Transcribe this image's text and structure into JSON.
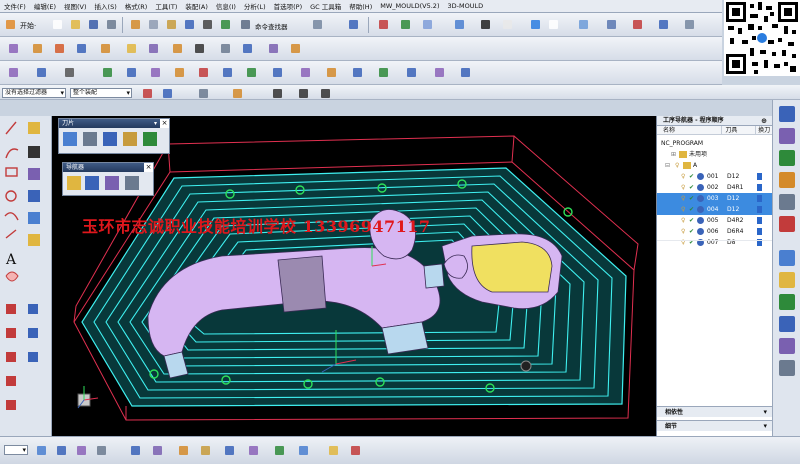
{
  "menu": [
    "文件(F)",
    "编辑(E)",
    "视图(V)",
    "插入(S)",
    "格式(R)",
    "工具(T)",
    "装配(A)",
    "信息(I)",
    "分析(L)",
    "首选项(P)",
    "GC 工具箱",
    "帮助(H)",
    "MW_MOULD(V5.2)",
    "3D-MOULD"
  ],
  "toolbar": {
    "start_label": "开始·",
    "command_finder_label": "命令查找器"
  },
  "selection_filter": {
    "value": "没有选择过滤器",
    "scope": "整个装配"
  },
  "palettes": {
    "tools_title": "刀片",
    "nav_title": "导航器"
  },
  "watermark": "玉环市志诚职业技能培训学校 13396947117",
  "colors": {
    "accent": "#3c8be0",
    "toolpath": "#3ff0f0",
    "part": "#c9a6ee",
    "watermark": "#e0171c",
    "stock_box": "#e03050"
  },
  "navigator": {
    "title": "工序导航器 - 程序顺序",
    "columns": [
      "名称",
      "刀具",
      "换刀"
    ],
    "root": "NC_PROGRAM",
    "unused": "未用项",
    "group": "A",
    "operations": [
      {
        "name": "001",
        "tool": "D12",
        "selected": false
      },
      {
        "name": "002",
        "tool": "D4R1",
        "selected": false
      },
      {
        "name": "003",
        "tool": "D12",
        "selected": true
      },
      {
        "name": "004",
        "tool": "D12",
        "selected": true
      },
      {
        "name": "005",
        "tool": "D4R2",
        "selected": false
      },
      {
        "name": "006",
        "tool": "D6R4",
        "selected": false
      },
      {
        "name": "007",
        "tool": "D8",
        "selected": false
      }
    ],
    "dependency_label": "相依性",
    "details_label": "细节"
  },
  "icons": [
    "siemens-nx-icon",
    "new-file-icon",
    "open-folder-icon",
    "save-icon",
    "cut-icon",
    "copy-icon",
    "paste-icon",
    "delete-icon",
    "undo-icon",
    "command-finder-icon",
    "fit-view-icon",
    "shaded-view-icon",
    "wcs-icon",
    "layer-icon",
    "qr-code-icon",
    "axis-triad-icon",
    "operation-navigator-icon",
    "resource-bar-icon"
  ]
}
